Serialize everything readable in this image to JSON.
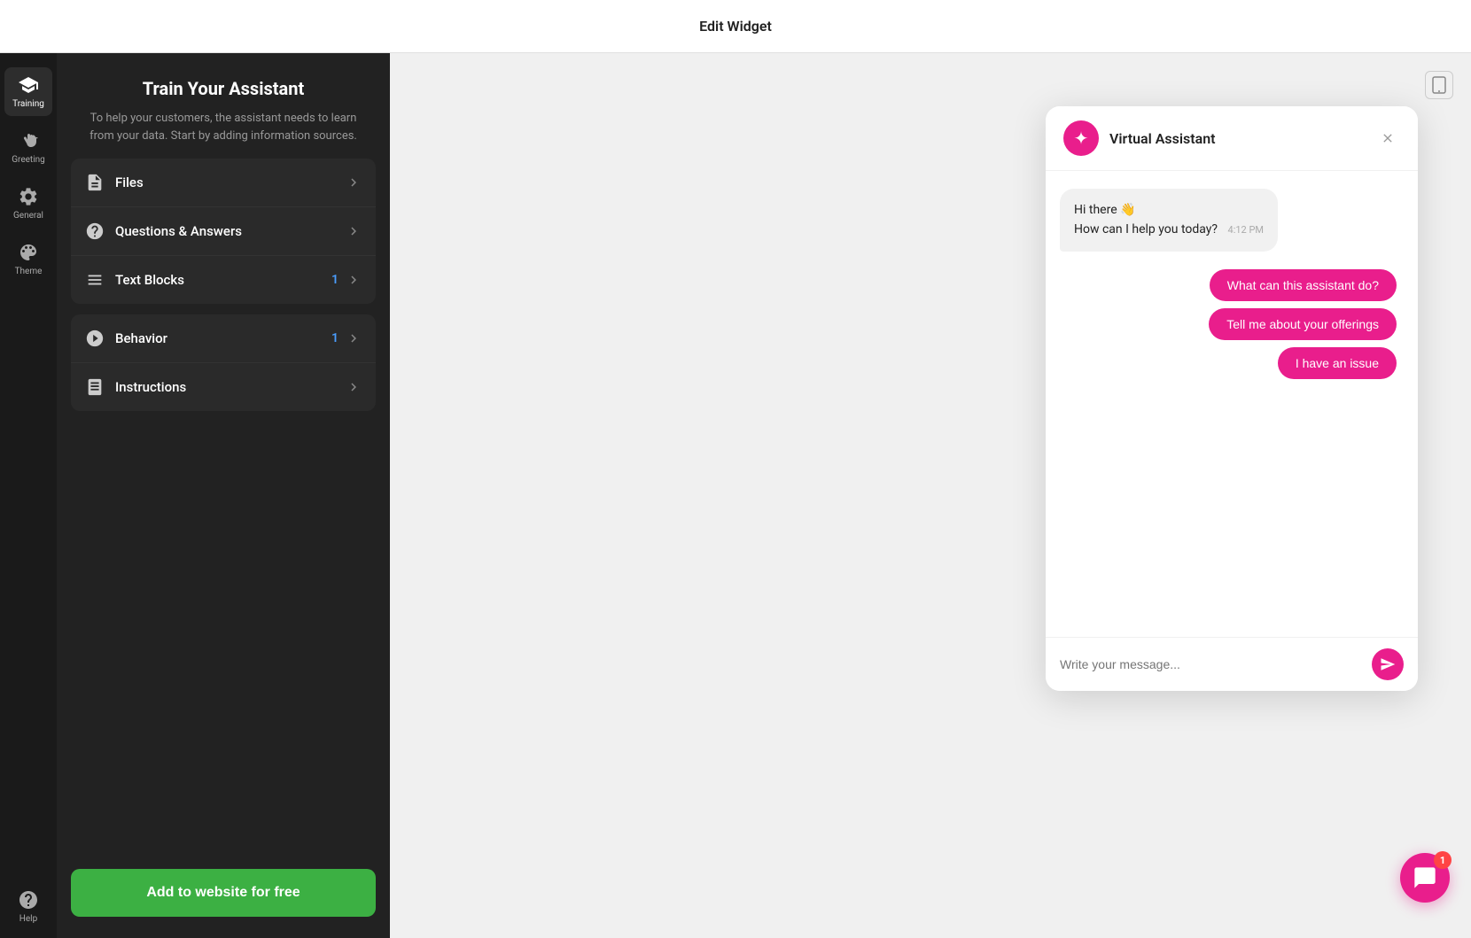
{
  "topBar": {
    "title": "Edit Widget"
  },
  "sidebar": {
    "items": [
      {
        "id": "training",
        "label": "Training",
        "icon": "graduation-cap",
        "active": true
      },
      {
        "id": "greeting",
        "label": "Greeting",
        "icon": "hand-wave"
      },
      {
        "id": "general",
        "label": "General",
        "icon": "gear"
      },
      {
        "id": "theme",
        "label": "Theme",
        "icon": "palette"
      },
      {
        "id": "help",
        "label": "Help",
        "icon": "question-circle"
      }
    ]
  },
  "trainingPanel": {
    "title": "Train Your Assistant",
    "description": "To help your customers, the assistant needs to learn from your data. Start by adding information sources.",
    "menuGroups": [
      {
        "items": [
          {
            "id": "files",
            "label": "Files",
            "badge": null,
            "icon": "file"
          },
          {
            "id": "qna",
            "label": "Questions & Answers",
            "badge": null,
            "icon": "question-circle"
          },
          {
            "id": "text-blocks",
            "label": "Text Blocks",
            "badge": "1",
            "icon": "text-block"
          }
        ]
      },
      {
        "items": [
          {
            "id": "behavior",
            "label": "Behavior",
            "badge": "1",
            "icon": "behavior"
          },
          {
            "id": "instructions",
            "label": "Instructions",
            "badge": null,
            "icon": "book"
          }
        ]
      }
    ],
    "addButton": "Add to website for free"
  },
  "chatWidget": {
    "title": "Virtual Assistant",
    "closeButton": "✕",
    "messages": [
      {
        "type": "bot",
        "text1": "Hi there 👋",
        "text2": "How can I help you today?",
        "time": "4:12 PM"
      }
    ],
    "quickReplies": [
      "What can this assistant do?",
      "Tell me about your offerings",
      "I have an issue"
    ],
    "inputPlaceholder": "Write your message...",
    "sendButton": "send"
  },
  "floatingButton": {
    "badge": "1"
  }
}
